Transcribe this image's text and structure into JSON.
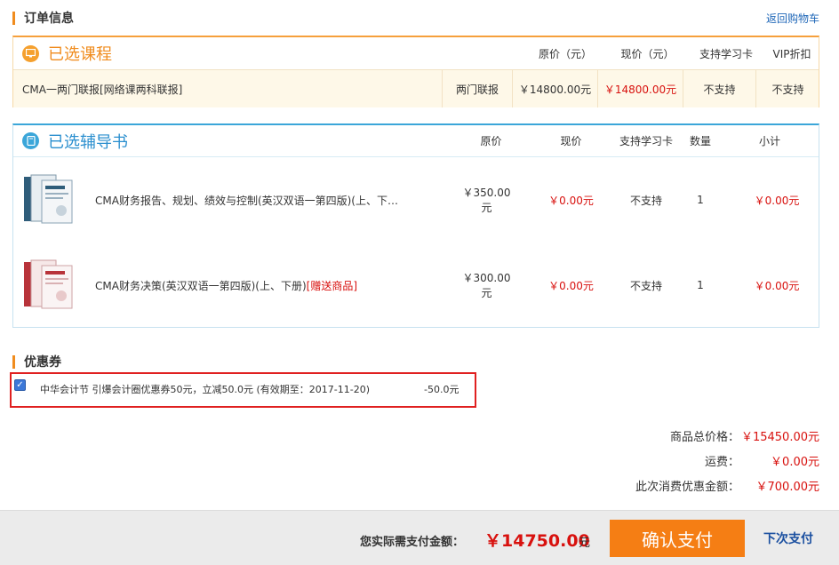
{
  "order_info": {
    "title": "订单信息",
    "back_link": "返回购物车"
  },
  "course_section": {
    "title": "已选课程",
    "headers": {
      "orig_price": "原价（元）",
      "cur_price": "现价（元）",
      "study_card": "支持学习卡",
      "vip": "VIP折扣"
    },
    "row": {
      "name": "CMA一两门联报[网络课两科联报]",
      "type": "两门联报",
      "orig_price": "￥14800.00元",
      "cur_price": "￥14800.00元",
      "study_card": "不支持",
      "vip": "不支持"
    }
  },
  "book_section": {
    "title": "已选辅导书",
    "headers": {
      "orig_price": "原价",
      "cur_price": "现价",
      "study_card": "支持学习卡",
      "qty": "数量",
      "subtotal": "小计"
    },
    "rows": [
      {
        "title": "CMA财务报告、规划、绩效与控制(英汉双语一第四版)(上、下…",
        "gift": "",
        "orig_price": "￥350.00元",
        "cur_price": "￥0.00元",
        "study_card": "不支持",
        "qty": "1",
        "subtotal": "￥0.00元"
      },
      {
        "title": "CMA财务决策(英汉双语一第四版)(上、下册)",
        "gift": "[赠送商品]",
        "orig_price": "￥300.00元",
        "cur_price": "￥0.00元",
        "study_card": "不支持",
        "qty": "1",
        "subtotal": "￥0.00元"
      }
    ]
  },
  "coupon": {
    "title": "优惠券",
    "text": "中华会计节 引爆会计圈优惠券50元，立减50.0元 (有效期至：2017-11-20)",
    "amount": "-50.0元"
  },
  "totals": {
    "goods_label": "商品总价格：",
    "goods_value": "￥15450.00元",
    "shipping_label": "运费：",
    "shipping_value": "￥0.00元",
    "discount_label": "此次消费优惠金额：",
    "discount_value": "￥700.00元"
  },
  "footer": {
    "pay_label": "您实际需支付金额：",
    "pay_amount": "￥14750.00",
    "pay_unit": "元",
    "confirm": "确认支付",
    "later": "下次支付"
  },
  "colors": {
    "accent_orange": "#f57e14",
    "price_red": "#d8110e",
    "course_blue": "#3ba6d9"
  }
}
